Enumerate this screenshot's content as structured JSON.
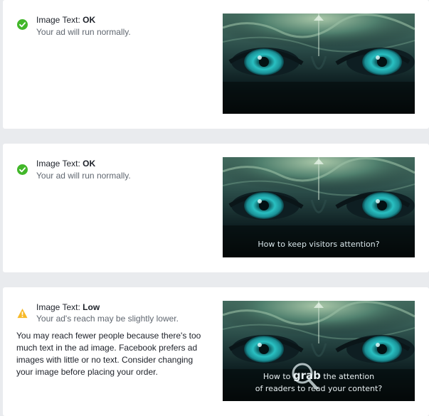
{
  "cards": [
    {
      "label": "Image Text:",
      "rating": "OK",
      "subtitle": "Your ad will run normally.",
      "status": "ok"
    },
    {
      "label": "Image Text:",
      "rating": "OK",
      "subtitle": "Your ad will run normally.",
      "status": "ok",
      "image_caption": "How to keep visitors attention?"
    },
    {
      "label": "Image Text:",
      "rating": "Low",
      "subtitle": "Your ad's reach may be slightly lower.",
      "status": "warning",
      "description": "You may reach fewer people because there's too much text in the ad image. Facebook prefers ad images with little or no text. Consider changing your image before placing your order.",
      "image_caption_line1_before": "How to",
      "image_caption_line1_emphasis": "grab",
      "image_caption_line1_after": "the attention",
      "image_caption_line2": "of readers to read your content?"
    }
  ],
  "colors": {
    "ok_icon": "#42b72a",
    "warning_icon": "#f7b928",
    "page_background": "#e9ebee",
    "eye_teal": "#2fc6c6"
  },
  "icons": {
    "ok": "check-circle-icon",
    "warning": "warning-triangle-icon"
  }
}
